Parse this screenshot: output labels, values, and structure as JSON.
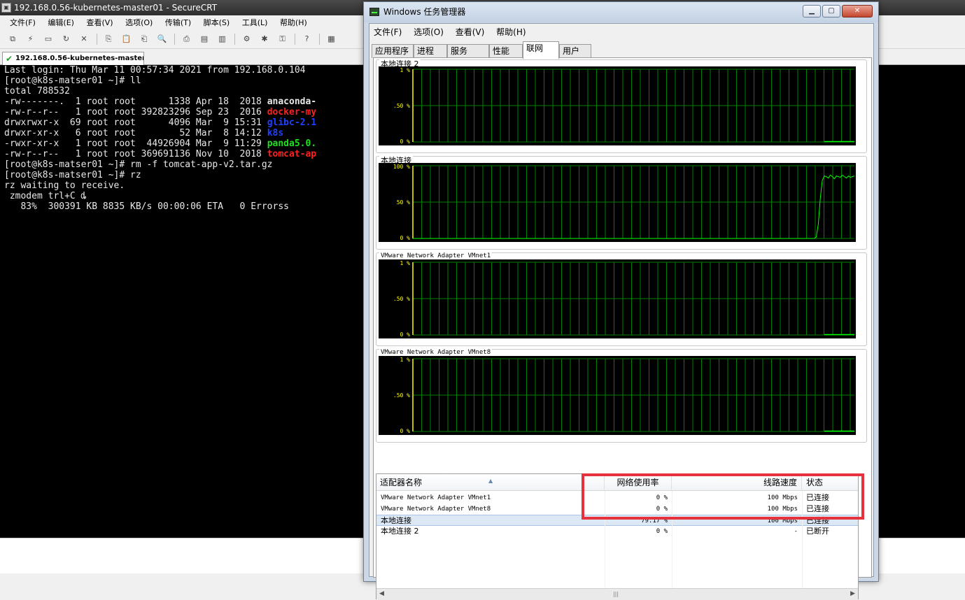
{
  "crt": {
    "title": "192.168.0.56-kubernetes-master01 - SecureCRT",
    "menu": [
      "文件(F)",
      "编辑(E)",
      "查看(V)",
      "选项(O)",
      "传输(T)",
      "脚本(S)",
      "工具(L)",
      "帮助(H)"
    ],
    "tab_label": "192.168.0.56-kubernetes-master01",
    "terminal_lines": [
      {
        "text": "Last login: Thu Mar 11 00:57:34 2021 from 192.168.0.104",
        "extra": "",
        "extra_color": ""
      },
      {
        "text": "[root@k8s-matser01 ~]# ll",
        "extra": "",
        "extra_color": ""
      },
      {
        "text": "total 788532",
        "extra": "",
        "extra_color": ""
      },
      {
        "text": "-rw-------.  1 root root      1338 Apr 18  2018 ",
        "extra": "anaconda-",
        "extra_color": "#e8e8e8"
      },
      {
        "text": "-rw-r--r--   1 root root 392823296 Sep 23  2016 ",
        "extra": "docker-my",
        "extra_color": "#ff2020"
      },
      {
        "text": "drwxrwxr-x  69 root root      4096 Mar  9 15:31 ",
        "extra": "glibc-2.1",
        "extra_color": "#2040ff"
      },
      {
        "text": "drwxr-xr-x   6 root root        52 Mar  8 14:12 ",
        "extra": "k8s",
        "extra_color": "#2040ff"
      },
      {
        "text": "-rwxr-xr-x   1 root root  44926904 Mar  9 11:29 ",
        "extra": "panda5.0.",
        "extra_color": "#20e020"
      },
      {
        "text": "-rw-r--r--   1 root root 369691136 Nov 10  2018 ",
        "extra": "tomcat-ap",
        "extra_color": "#ff2020"
      },
      {
        "text": "[root@k8s-matser01 ~]# rm -f tomcat-app-v2.tar.gz",
        "extra": "",
        "extra_color": ""
      },
      {
        "text": "[root@k8s-matser01 ~]# rz",
        "extra": "",
        "extra_color": ""
      },
      {
        "text": "rz waiting to receive.",
        "extra": "",
        "extra_color": ""
      },
      {
        "text": " zmodem trl+C ȡ",
        "extra": "",
        "extra_color": ""
      },
      {
        "text": "   83%  300391 KB 8835 KB/s 00:00:06 ETA   0 Errorss",
        "extra": "",
        "extra_color": ""
      }
    ]
  },
  "taskmgr": {
    "title": "Windows 任务管理器",
    "menu": [
      "文件(F)",
      "选项(O)",
      "查看(V)",
      "帮助(H)"
    ],
    "tabs": [
      "应用程序",
      "进程",
      "服务",
      "性能",
      "联网",
      "用户"
    ],
    "active_tab": "联网",
    "graphs": [
      {
        "label": "本地连接 2",
        "ticks": [
          "1 %",
          ".50 %",
          "0 %"
        ],
        "ymax": 1,
        "series": []
      },
      {
        "label": "本地连接",
        "ticks": [
          "100 %",
          "50 %",
          "0 %"
        ],
        "ymax": 100,
        "series": [
          0,
          0,
          0,
          0,
          0,
          0,
          0,
          0,
          0,
          0,
          0,
          0,
          0,
          0,
          0,
          0,
          0,
          0,
          0,
          0,
          0,
          0,
          0,
          0,
          0,
          0,
          0,
          0,
          0,
          0,
          0,
          0,
          0,
          0,
          0,
          0,
          0,
          0,
          0,
          0,
          0,
          0,
          0,
          0,
          0,
          0,
          0,
          0,
          0,
          0,
          0,
          0,
          0,
          0,
          0,
          0,
          0,
          0,
          0,
          0,
          0,
          0,
          0,
          0,
          0,
          0,
          0,
          0,
          0,
          0,
          0,
          0,
          0,
          0,
          0,
          0,
          0,
          0,
          0,
          0,
          0,
          0,
          0,
          0,
          0,
          0,
          0,
          0,
          0,
          0,
          0,
          0,
          0,
          0,
          0,
          0,
          0,
          0,
          0,
          0,
          0,
          0,
          0,
          0,
          0,
          0,
          0,
          0,
          0,
          0,
          0,
          0,
          0,
          0,
          0,
          0,
          0,
          0,
          0,
          0,
          0,
          0,
          0,
          0,
          0,
          0,
          0,
          0,
          0,
          0,
          0,
          0,
          0,
          0,
          0,
          0,
          0,
          0,
          0,
          0,
          0,
          0,
          0,
          0,
          0,
          0,
          0,
          0,
          0,
          0,
          0,
          0,
          0,
          0,
          0,
          0,
          0,
          0,
          0,
          0,
          0,
          0,
          0,
          0,
          0,
          0,
          0,
          0,
          0,
          0,
          0,
          0,
          0,
          0,
          0,
          0,
          0,
          0,
          0,
          0,
          0,
          0,
          0,
          0,
          0,
          0,
          0,
          0,
          0,
          0,
          0,
          0,
          0,
          0,
          0,
          0,
          0,
          0,
          0,
          0,
          0,
          2,
          20,
          55,
          80,
          86,
          85,
          83,
          87,
          85,
          82,
          86,
          85,
          84,
          87,
          85,
          83,
          86,
          84,
          85,
          86
        ]
      },
      {
        "label": "VMware Network Adapter VMnet1",
        "ticks": [
          "1 %",
          ".50 %",
          "0 %"
        ],
        "ymax": 1,
        "series": []
      },
      {
        "label": "VMware Network Adapter VMnet8",
        "ticks": [
          "1 %",
          ".50 %",
          "0 %"
        ],
        "ymax": 1,
        "series": []
      }
    ],
    "table": {
      "headers": {
        "name": "适配器名称",
        "usage": "网络使用率",
        "speed": "线路速度",
        "status": "状态"
      },
      "rows": [
        {
          "name": "VMware Network Adapter VMnet1",
          "usage": "0 %",
          "speed": "100 Mbps",
          "status": "已连接",
          "selected": false
        },
        {
          "name": "VMware Network Adapter VMnet8",
          "usage": "0 %",
          "speed": "100 Mbps",
          "status": "已连接",
          "selected": false
        },
        {
          "name": "本地连接",
          "usage": "79.17 %",
          "speed": "100 Mbps",
          "status": "已连接",
          "selected": true
        },
        {
          "name": "本地连接 2",
          "usage": "0 %",
          "speed": "-",
          "status": "已断开",
          "selected": false
        }
      ]
    }
  },
  "colors": {
    "graph_grid": "#008000",
    "graph_line": "#00ff00",
    "graph_axis": "#ffff00",
    "highlight": "#e6323c"
  }
}
